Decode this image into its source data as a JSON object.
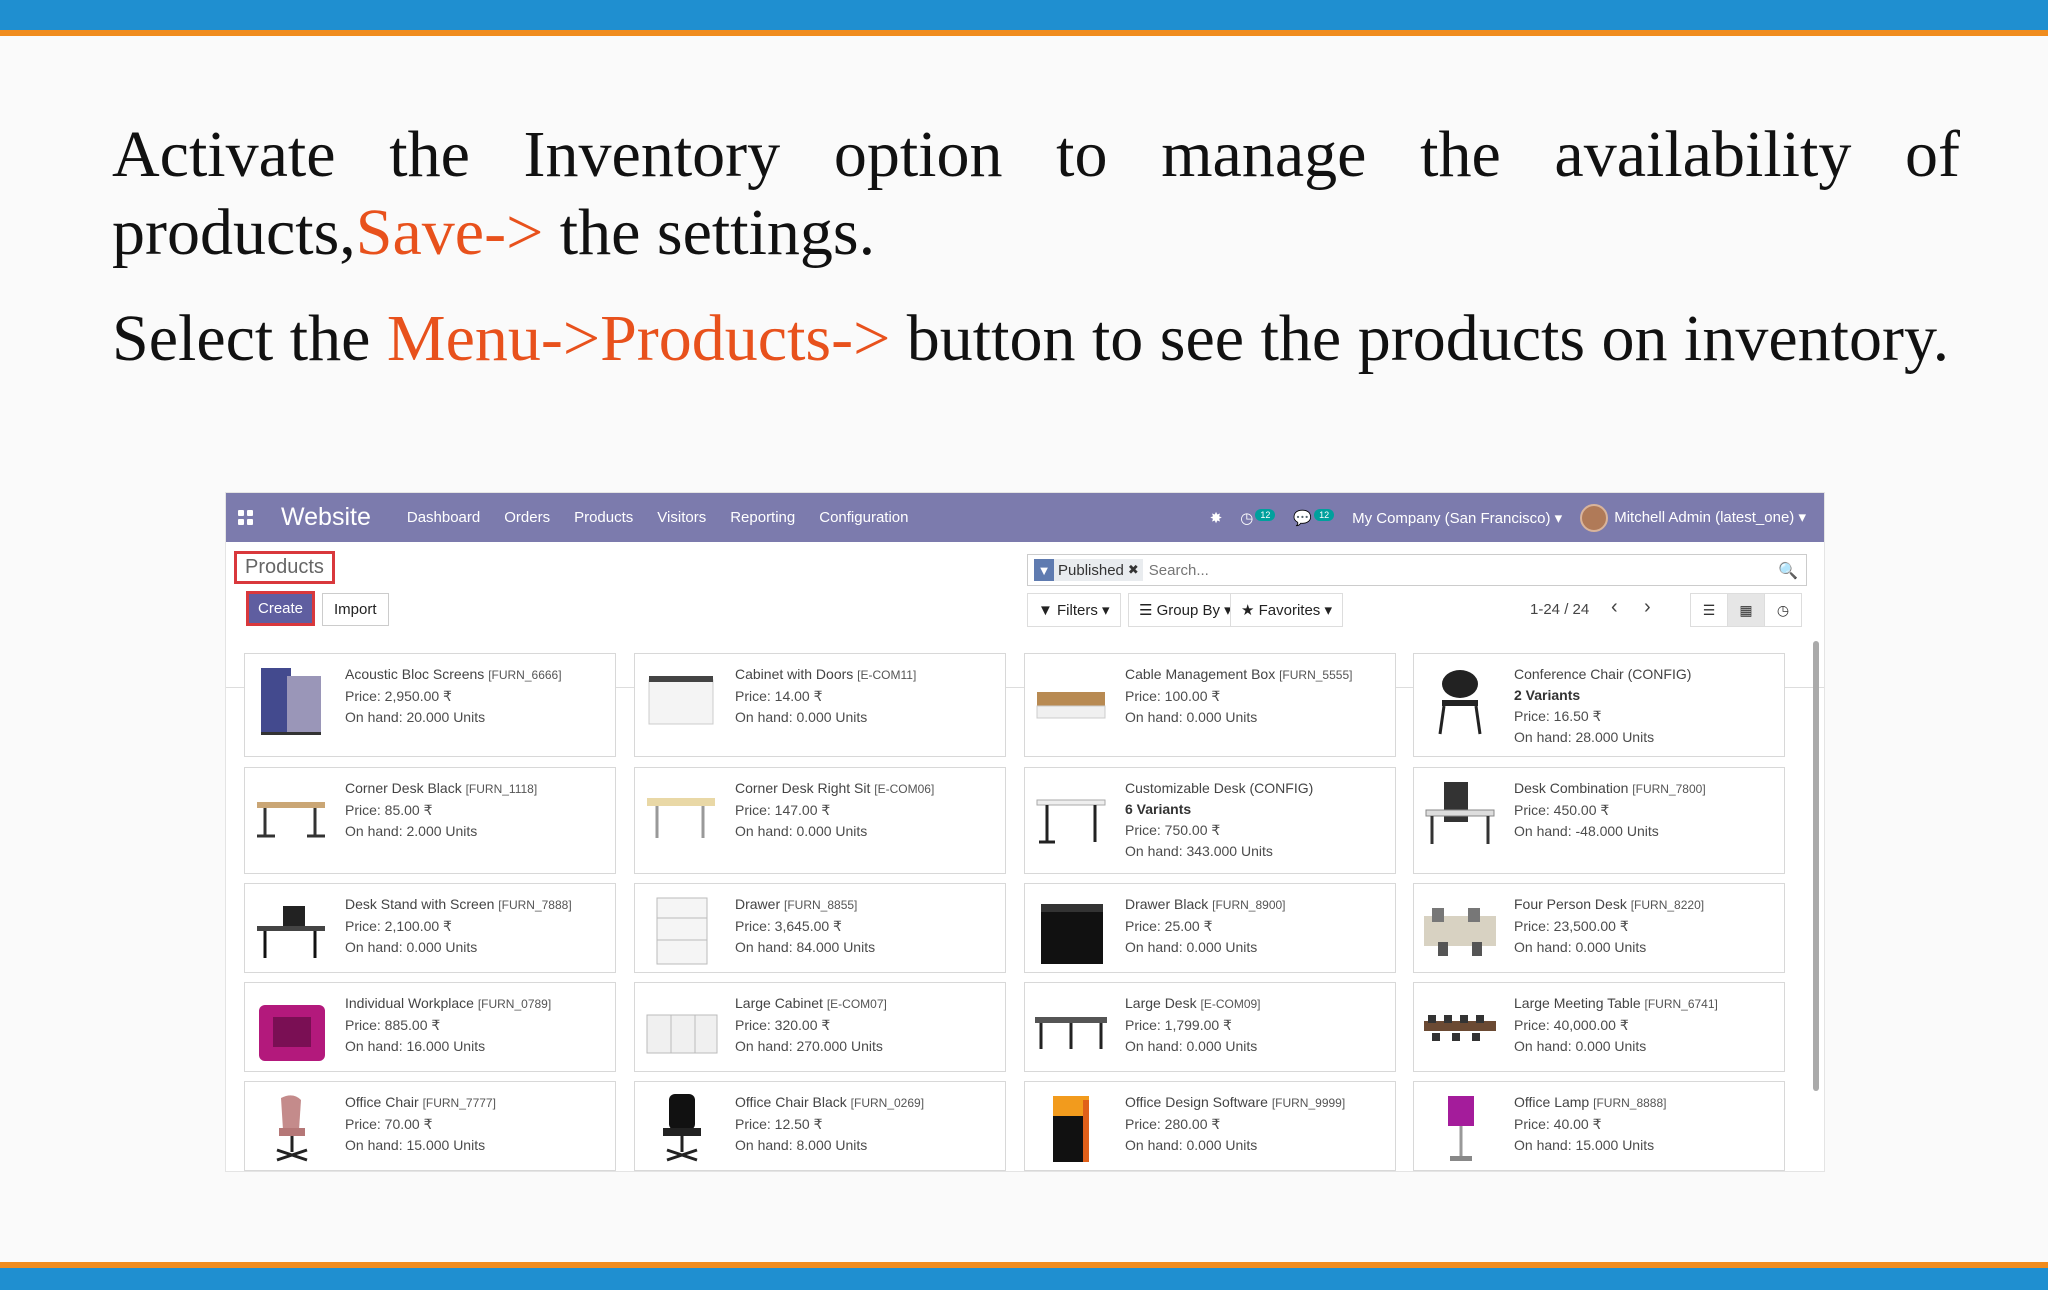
{
  "slide": {
    "p1_a": "Activate the Inventory option to manage the availability of products,",
    "p1_hl": "Save->",
    "p1_b": " the settings.",
    "p2_a": "Select the ",
    "p2_hl": "Menu->Products->",
    "p2_b": " button to see the products on inventory."
  },
  "topbar": {
    "brand": "Website",
    "nav": [
      "Dashboard",
      "Orders",
      "Products",
      "Visitors",
      "Reporting",
      "Configuration"
    ],
    "activity_count": "12",
    "message_count": "12",
    "company": "My Company (San Francisco)",
    "user": "Mitchell Admin (latest_one)"
  },
  "control_panel": {
    "breadcrumb": "Products",
    "create_label": "Create",
    "import_label": "Import",
    "facet_label": "Published",
    "search_placeholder": "Search...",
    "filters_label": "Filters",
    "groupby_label": "Group By",
    "favorites_label": "Favorites",
    "pager": "1-24 / 24"
  },
  "products": [
    {
      "name": "Acoustic Bloc Screens",
      "ref": "[FURN_6666]",
      "price": "Price: 2,950.00 ₹",
      "onhand": "On hand: 20.000 Units",
      "thumb": "screen"
    },
    {
      "name": "Cabinet with Doors",
      "ref": "[E-COM11]",
      "price": "Price: 14.00 ₹",
      "onhand": "On hand: 0.000 Units",
      "thumb": "cabinet"
    },
    {
      "name": "Cable Management Box",
      "ref": "[FURN_5555]",
      "price": "Price: 100.00 ₹",
      "onhand": "On hand: 0.000 Units",
      "thumb": "box"
    },
    {
      "name": "Conference Chair (CONFIG)",
      "ref": "",
      "variants": "2 Variants",
      "price": "Price: 16.50 ₹",
      "onhand": "On hand: 28.000 Units",
      "thumb": "chair"
    },
    {
      "name": "Corner Desk Black",
      "ref": "[FURN_1118]",
      "price": "Price: 85.00 ₹",
      "onhand": "On hand: 2.000 Units",
      "thumb": "desk"
    },
    {
      "name": "Corner Desk Right Sit",
      "ref": "[E-COM06]",
      "price": "Price: 147.00 ₹",
      "onhand": "On hand: 0.000 Units",
      "thumb": "desk-light"
    },
    {
      "name": "Customizable Desk (CONFIG)",
      "ref": "",
      "variants": "6 Variants",
      "price": "Price: 750.00 ₹",
      "onhand": "On hand: 343.000 Units",
      "thumb": "desk-white"
    },
    {
      "name": "Desk Combination",
      "ref": "[FURN_7800]",
      "price": "Price: 450.00 ₹",
      "onhand": "On hand: -48.000 Units",
      "thumb": "desk-combo"
    },
    {
      "name": "Desk Stand with Screen",
      "ref": "[FURN_7888]",
      "price": "Price: 2,100.00 ₹",
      "onhand": "On hand: 0.000 Units",
      "thumb": "desk-screen"
    },
    {
      "name": "Drawer",
      "ref": "[FURN_8855]",
      "price": "Price: 3,645.00 ₹",
      "onhand": "On hand: 84.000 Units",
      "thumb": "drawer"
    },
    {
      "name": "Drawer Black",
      "ref": "[FURN_8900]",
      "price": "Price: 25.00 ₹",
      "onhand": "On hand: 0.000 Units",
      "thumb": "drawer-black"
    },
    {
      "name": "Four Person Desk",
      "ref": "[FURN_8220]",
      "price": "Price: 23,500.00 ₹",
      "onhand": "On hand: 0.000 Units",
      "thumb": "office"
    },
    {
      "name": "Individual Workplace",
      "ref": "[FURN_0789]",
      "price": "Price: 885.00 ₹",
      "onhand": "On hand: 16.000 Units",
      "thumb": "booth"
    },
    {
      "name": "Large Cabinet",
      "ref": "[E-COM07]",
      "price": "Price: 320.00 ₹",
      "onhand": "On hand: 270.000 Units",
      "thumb": "large-cabinet"
    },
    {
      "name": "Large Desk",
      "ref": "[E-COM09]",
      "price": "Price: 1,799.00 ₹",
      "onhand": "On hand: 0.000 Units",
      "thumb": "large-desk"
    },
    {
      "name": "Large Meeting Table",
      "ref": "[FURN_6741]",
      "price": "Price: 40,000.00 ₹",
      "onhand": "On hand: 0.000 Units",
      "thumb": "meeting"
    },
    {
      "name": "Office Chair",
      "ref": "[FURN_7777]",
      "price": "Price: 70.00 ₹",
      "onhand": "On hand: 15.000 Units",
      "thumb": "office-chair"
    },
    {
      "name": "Office Chair Black",
      "ref": "[FURN_0269]",
      "price": "Price: 12.50 ₹",
      "onhand": "On hand: 8.000 Units",
      "thumb": "chair-black"
    },
    {
      "name": "Office Design Software",
      "ref": "[FURN_9999]",
      "price": "Price: 280.00 ₹",
      "onhand": "On hand: 0.000 Units",
      "thumb": "software"
    },
    {
      "name": "Office Lamp",
      "ref": "[FURN_8888]",
      "price": "Price: 40.00 ₹",
      "onhand": "On hand: 15.000 Units",
      "thumb": "lamp"
    }
  ]
}
